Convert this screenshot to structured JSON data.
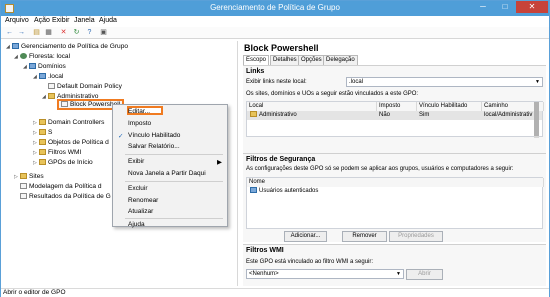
{
  "window": {
    "title": "Gerenciamento de Política de Grupo",
    "minimize": "─",
    "maximize": "□",
    "close": "✕"
  },
  "menu": [
    "Arquivo",
    "Ação",
    "Exibir",
    "Janela",
    "Ajuda"
  ],
  "toolbar": {
    "icons": [
      "back-icon",
      "forward-icon",
      "folder-icon",
      "grid-icon",
      "delete-icon",
      "refresh-icon",
      "help-icon",
      "properties-icon"
    ],
    "glyphs": [
      "←",
      "→",
      "▤",
      "▦",
      "✕",
      "↻",
      "?",
      "▣"
    ]
  },
  "tree": {
    "root": "Gerenciamento de Política de Grupo",
    "forest": "Floresta:",
    "forest_name": "local",
    "domains": "Domínios",
    "domain": ".local",
    "default_policy": "Default Domain Policy",
    "administrativo": "Administrativo",
    "selected": "Block Powershell",
    "domain_controllers": "Domain Controllers",
    "s_partial": "S",
    "objetos": "Objetos de Política d",
    "filtros": "Filtros WMI",
    "gpos_inicio": "GPOs de Início",
    "sites": "Sites",
    "modelagem": "Modelagem da Política d",
    "resultados": "Resultados da Política de G"
  },
  "context_menu": {
    "items": [
      "Editar...",
      "Imposto",
      "Vínculo Habilitado",
      "Salvar Relatório...",
      "Exibir",
      "Nova Janela a Partir Daqui",
      "Excluir",
      "Renomear",
      "Atualizar",
      "Ajuda"
    ],
    "check": "✓",
    "submenu_arrow": "▶"
  },
  "details": {
    "title": "Block Powershell",
    "tabs": [
      "Escopo",
      "Detalhes",
      "Opções",
      "Delegação"
    ],
    "links": {
      "heading": "Links",
      "show_label": "Exibir links neste local:",
      "location": ".local",
      "description": "Os sites, domínios e UOs a seguir estão vinculados a este GPO:",
      "headers": [
        "Local",
        "Imposto",
        "Vínculo Habilitado",
        "Caminho"
      ],
      "row": [
        "Administrativo",
        "Não",
        "Sim",
        "local/Administrativ"
      ]
    },
    "security": {
      "heading": "Filtros de Segurança",
      "description": "As configurações deste GPO só se podem se aplicar aos grupos, usuários e computadores a seguir:",
      "header": "Nome",
      "item": "Usuários autenticados",
      "buttons": [
        "Adicionar...",
        "Remover",
        "Propriedades"
      ]
    },
    "wmi": {
      "heading": "Filtros WMI",
      "description": "Este GPO está vinculado ao filtro WMI a seguir:",
      "value": "<Nenhum>",
      "open": "Abrir"
    }
  },
  "status": "Abrir o editor de GPO",
  "colors": {
    "title_bar": "#4f9ed8",
    "highlight": "#f07b21",
    "close": "#c7433a"
  }
}
